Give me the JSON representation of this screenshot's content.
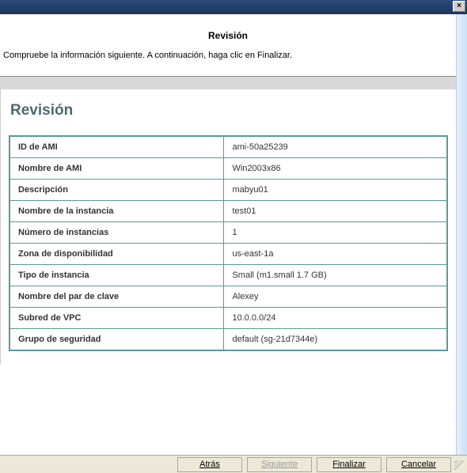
{
  "close_label": "×",
  "header": {
    "title": "Revisión",
    "description": "Compruebe la información siguiente. A continuación, haga clic en Finalizar."
  },
  "section_title": "Revisión",
  "rows": [
    {
      "label": "ID de AMI",
      "value": "ami-50a25239"
    },
    {
      "label": "Nombre de AMI",
      "value": "Win2003x86"
    },
    {
      "label": "Descripción",
      "value": "mabyu01"
    },
    {
      "label": "Nombre de la instancia",
      "value": "test01"
    },
    {
      "label": "Número de instancias",
      "value": "1"
    },
    {
      "label": "Zona de disponibilidad",
      "value": "us-east-1a"
    },
    {
      "label": "Tipo de instancia",
      "value": "Small (m1.small 1.7 GB)"
    },
    {
      "label": "Nombre del par de clave",
      "value": "Alexey"
    },
    {
      "label": "Subred de VPC",
      "value": "10.0.0.0/24"
    },
    {
      "label": "Grupo de seguridad",
      "value": "default (sg-21d7344e)"
    }
  ],
  "buttons": {
    "back": "Atrás",
    "next": "Siguiente",
    "finish": "Finalizar",
    "cancel": "Cancelar"
  }
}
